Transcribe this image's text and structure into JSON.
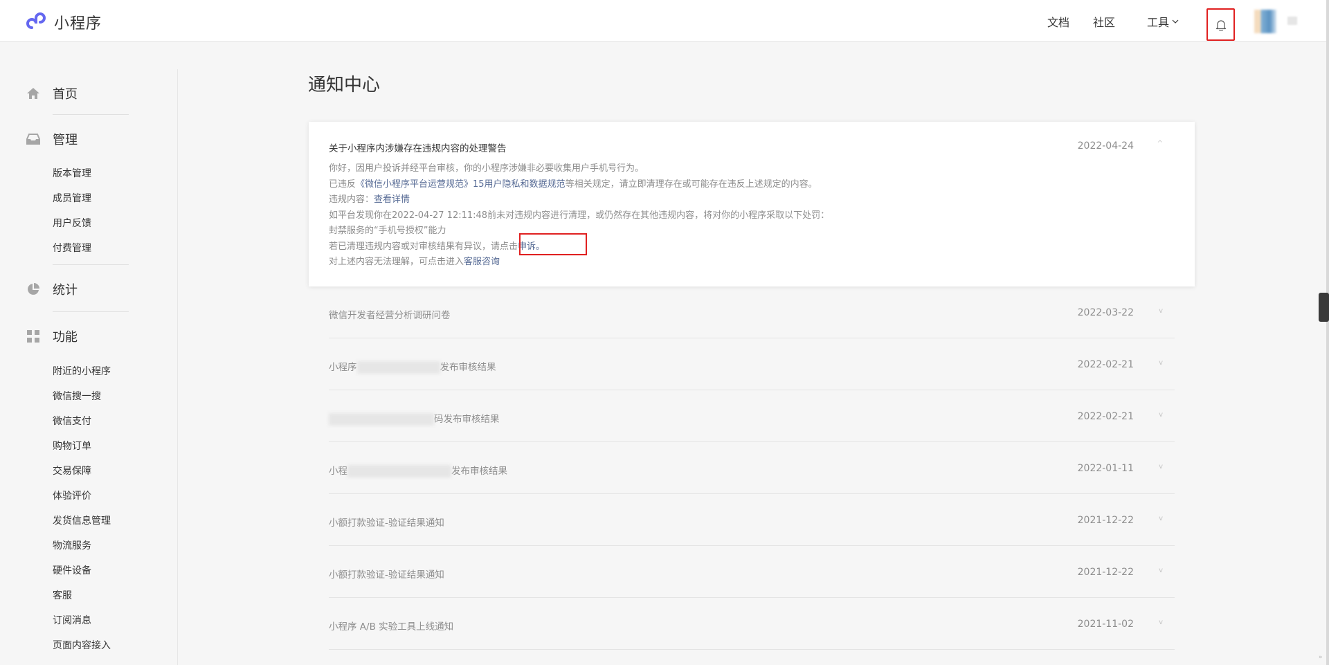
{
  "header": {
    "app_title": "小程序",
    "nav": {
      "docs": "文档",
      "community": "社区",
      "tools": "工具"
    }
  },
  "sidebar": {
    "sections": [
      {
        "label": "首页",
        "icon": "home-icon"
      },
      {
        "label": "管理",
        "icon": "inbox-icon"
      },
      {
        "label": "统计",
        "icon": "pie-chart-icon"
      },
      {
        "label": "功能",
        "icon": "grid-icon"
      }
    ],
    "manage_items": [
      "版本管理",
      "成员管理",
      "用户反馈",
      "付费管理"
    ],
    "feature_items": [
      "附近的小程序",
      "微信搜一搜",
      "微信支付",
      "购物订单",
      "交易保障",
      "体验评价",
      "发货信息管理",
      "物流服务",
      "硬件设备",
      "客服",
      "订阅消息",
      "页面内容接入"
    ]
  },
  "main": {
    "title": "通知中心",
    "expanded": {
      "title": "关于小程序内涉嫌存在违规内容的处理警告",
      "date": "2022-04-24",
      "line1": "你好，因用户投诉并经平台审核，你的小程序涉嫌非必要收集用户手机号行为。",
      "line2_pre": "已违反",
      "line2_link": "《微信小程序平台运营规范》15用户隐私和数据规范",
      "line2_post": "等相关规定，请立即清理存在或可能存在违反上述规定的内容。",
      "line3_pre": "违规内容：",
      "line3_link": "查看详情",
      "line4": "如平台发现你在2022-04-27 12:11:48前未对违规内容进行清理，或仍然存在其他违规内容，将对你的小程序采取以下处罚：",
      "line5": "封禁服务的“手机号授权”能力",
      "line6_pre": "若已清理违规内容或对审核结果有异议，请点击",
      "line6_link": "申诉。",
      "line7_pre": "对上述内容无法理解，可点击进入",
      "line7_link": "客服咨询"
    },
    "notices": [
      {
        "title": "微信开发者经营分析调研问卷",
        "date": "2022-03-22"
      },
      {
        "title_pre": "小程序",
        "title_post": "发布审核结果",
        "date": "2022-02-21"
      },
      {
        "title_pre": "",
        "title_post": "码发布审核结果",
        "date": "2022-02-21"
      },
      {
        "title_pre": "小程",
        "title_post": "发布审核结果",
        "date": "2022-01-11"
      },
      {
        "title": "小额打款验证-验证结果通知",
        "date": "2021-12-22"
      },
      {
        "title": "小额打款验证-验证结果通知",
        "date": "2021-12-22"
      },
      {
        "title": "小程序 A/B 实验工具上线通知",
        "date": "2021-11-02"
      }
    ]
  }
}
